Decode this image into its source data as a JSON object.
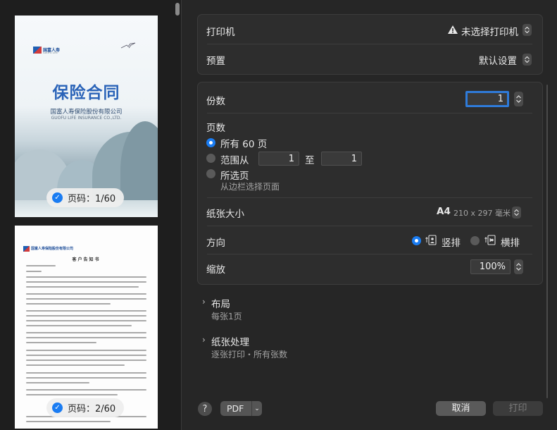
{
  "preview": {
    "page1": {
      "logo_text": "国富人寿",
      "logo_sub": "GUOFU LIFE",
      "title": "保险合同",
      "company": "国富人寿保险股份有限公司",
      "company_en": "GUOFU LIFE INSURANCE CO.,LTD.",
      "badge": "页码：1/60",
      "selected": true
    },
    "page2": {
      "logo_text": "国富人寿保险股份有限公司",
      "heading": "客户告知书",
      "badge": "页码：2/60",
      "selected": true
    }
  },
  "printer": {
    "label": "打印机",
    "value": "未选择打印机",
    "icon": "warning-icon"
  },
  "presets": {
    "label": "预置",
    "value": "默认设置"
  },
  "copies": {
    "label": "份数",
    "value": "1"
  },
  "pages": {
    "label": "页数",
    "all_label": "所有 60 页",
    "range_label": "范围从",
    "range_from": "1",
    "range_to_label": "至",
    "range_to": "1",
    "selected_label": "所选页",
    "selected_hint": "从边栏选择页面",
    "selected_option": "all"
  },
  "paper_size": {
    "label": "纸张大小",
    "value": "A4",
    "dims": "210 x 297 毫米"
  },
  "orientation": {
    "label": "方向",
    "portrait": "竖排",
    "landscape": "横排",
    "selected": "portrait"
  },
  "scale": {
    "label": "缩放",
    "value": "100%"
  },
  "layout": {
    "label": "布局",
    "summary": "每张1页"
  },
  "paper_handling": {
    "label": "纸张处理",
    "summary": "逐张打印・所有张数"
  },
  "bottom": {
    "help": "?",
    "pdf": "PDF",
    "cancel": "取消",
    "print": "打印"
  },
  "colors": {
    "accent": "#1a7cf2",
    "background": "#262626",
    "group": "#2d2d2d"
  }
}
